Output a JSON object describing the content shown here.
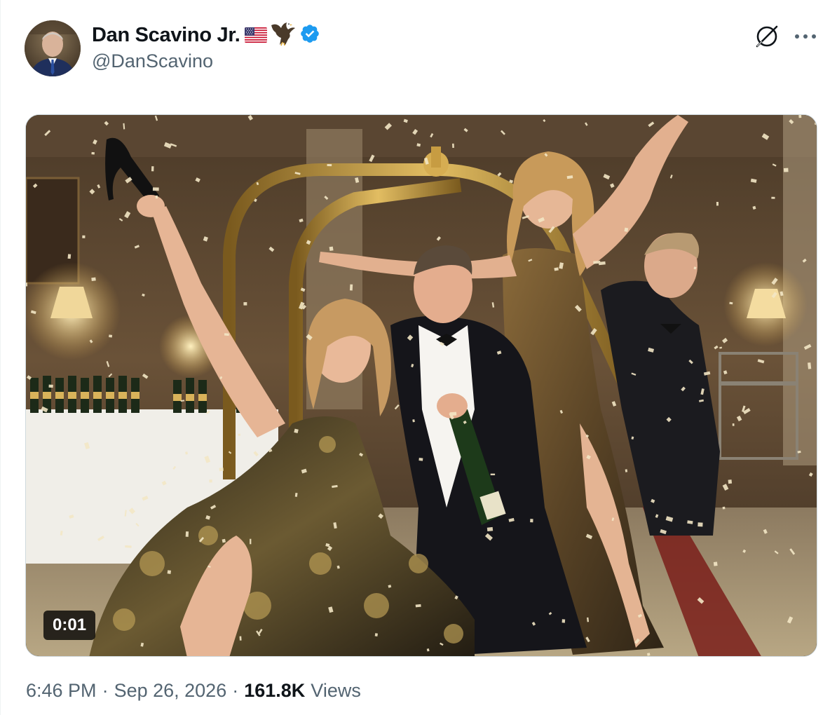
{
  "author": {
    "display_name": "Dan Scavino Jr.",
    "handle": "@DanScavino",
    "verified": true,
    "name_emoji": [
      "us-flag",
      "eagle"
    ]
  },
  "header_actions": {
    "grok_icon": "grok-slash-circle-icon",
    "more_icon": "more-dots-icon"
  },
  "media": {
    "type": "video",
    "duration": "0:01",
    "description_icon": "video-frame"
  },
  "meta": {
    "time": "6:46 PM",
    "separator": "·",
    "date": "Sep 26, 2026",
    "views_count": "161.8K",
    "views_label": "Views"
  },
  "colors": {
    "verified_blue": "#1d9bf0",
    "secondary_text": "#536471",
    "primary_text": "#0f1419"
  }
}
